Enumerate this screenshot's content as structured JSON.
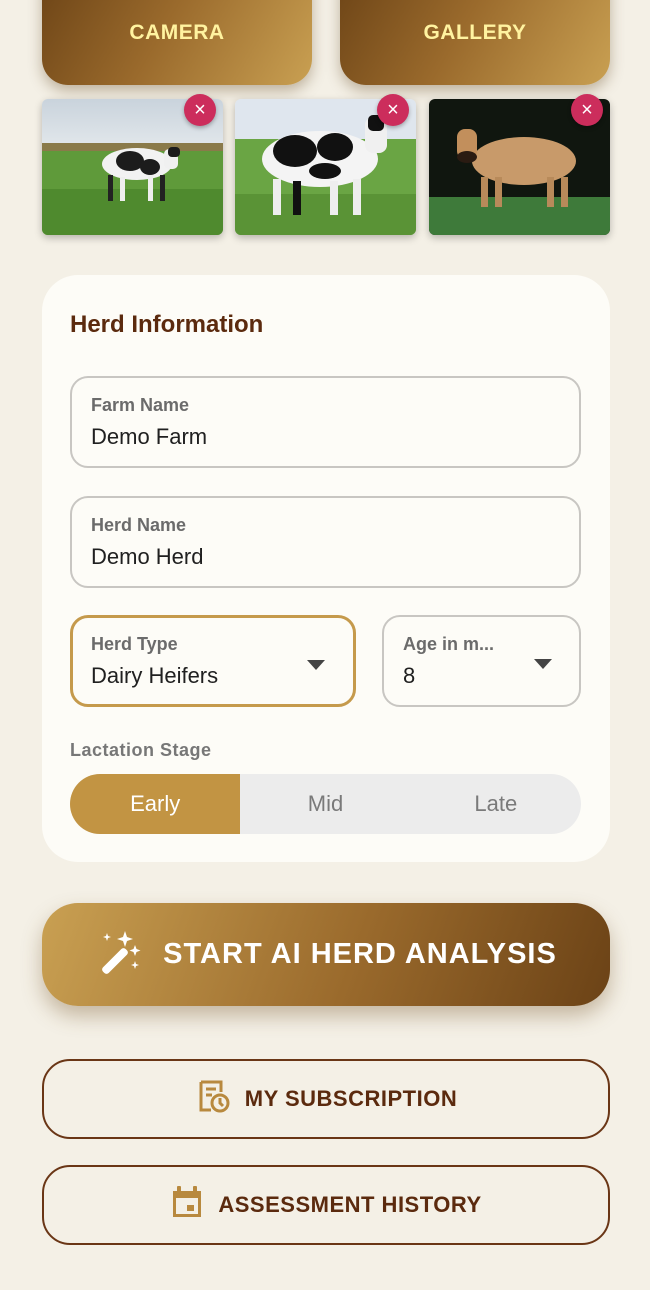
{
  "top_buttons": {
    "camera_label": "CAMERA",
    "gallery_label": "GALLERY"
  },
  "photos": [
    {
      "icon": "cow-photo-1",
      "remove": "×"
    },
    {
      "icon": "cow-photo-2",
      "remove": "×"
    },
    {
      "icon": "cow-photo-3",
      "remove": "×"
    }
  ],
  "herd_info": {
    "title": "Herd Information",
    "farm_name": {
      "label": "Farm Name",
      "value": "Demo Farm"
    },
    "herd_name": {
      "label": "Herd Name",
      "value": "Demo Herd"
    },
    "herd_type": {
      "label": "Herd Type",
      "value": "Dairy Heifers"
    },
    "age": {
      "label": "Age in m...",
      "value": "8"
    },
    "lactation_label": "Lactation Stage",
    "lactation_options": [
      "Early",
      "Mid",
      "Late"
    ],
    "lactation_selected": "Early"
  },
  "actions": {
    "start_label": "START AI HERD ANALYSIS",
    "subscription_label": "MY SUBSCRIPTION",
    "history_label": "ASSESSMENT HISTORY"
  },
  "colors": {
    "accent": "#c29443",
    "brown_dark": "#5b2a0e",
    "remove": "#cc2d5c",
    "background": "#f4f0e6"
  }
}
